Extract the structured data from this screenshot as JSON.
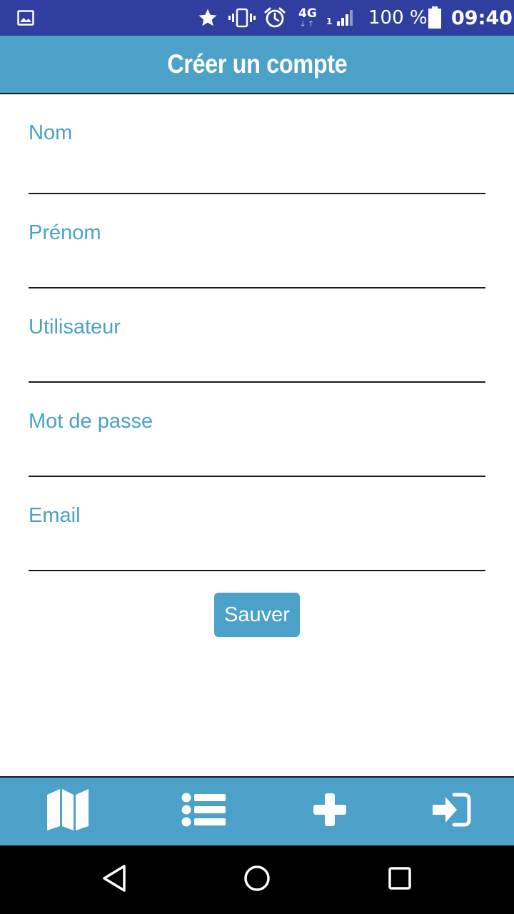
{
  "status_bar": {
    "network_type": "4G",
    "network_arrows": "↓↑",
    "sim_slot": "1",
    "battery_percent": "100 %",
    "time": "09:40",
    "icons": [
      "image-icon",
      "star-icon",
      "vibrate-icon",
      "alarm-icon",
      "signal-icon",
      "battery-icon"
    ]
  },
  "header": {
    "title": "Créer un compte"
  },
  "form": {
    "fields": [
      {
        "label": "Nom",
        "value": ""
      },
      {
        "label": "Prénom",
        "value": ""
      },
      {
        "label": "Utilisateur",
        "value": ""
      },
      {
        "label": "Mot de passe",
        "value": ""
      },
      {
        "label": "Email",
        "value": ""
      }
    ],
    "save_label": "Sauver"
  },
  "bottom_nav": {
    "items": [
      {
        "icon": "map-icon"
      },
      {
        "icon": "list-icon"
      },
      {
        "icon": "plus-icon"
      },
      {
        "icon": "sign-in-icon"
      }
    ]
  },
  "system_nav": {
    "icons": [
      "back-icon",
      "home-icon",
      "recent-apps-icon"
    ]
  },
  "colors": {
    "status_bar": "#303f9f",
    "accent": "#4ba1c8",
    "system_nav": "#000000"
  }
}
